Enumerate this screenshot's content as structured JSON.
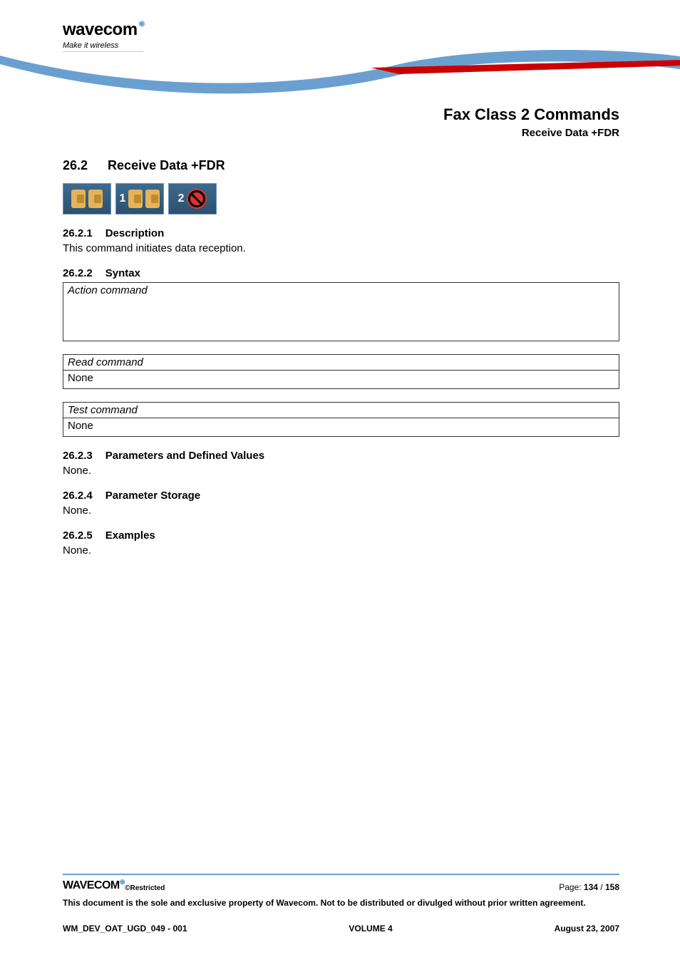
{
  "logo": {
    "brand": "wavecom",
    "tagline": "Make it wireless"
  },
  "page_header": {
    "title": "Fax Class 2 Commands",
    "subtitle": "Receive Data +FDR"
  },
  "section": {
    "number": "26.2",
    "title": "Receive Data +FDR"
  },
  "badges": [
    {
      "num": "",
      "kind": "sim"
    },
    {
      "num": "1",
      "kind": "sim"
    },
    {
      "num": "2",
      "kind": "no"
    }
  ],
  "sub1": {
    "number": "26.2.1",
    "title": "Description",
    "text": "This command initiates data reception."
  },
  "sub2": {
    "number": "26.2.2",
    "title": "Syntax"
  },
  "boxes": {
    "action": {
      "label": "Action command",
      "value": ""
    },
    "read": {
      "label": "Read command",
      "value": "None"
    },
    "test": {
      "label": "Test command",
      "value": "None"
    }
  },
  "sub3": {
    "number": "26.2.3",
    "title": "Parameters and Defined Values",
    "text": "None."
  },
  "sub4": {
    "number": "26.2.4",
    "title": "Parameter Storage",
    "text": "None."
  },
  "sub5": {
    "number": "26.2.5",
    "title": "Examples",
    "text": "None."
  },
  "footer": {
    "brand": "WAVECOM",
    "restricted": "©Restricted",
    "page_label": "Page: ",
    "page_current": "134",
    "page_sep": " / ",
    "page_total": "158",
    "disclaimer": "This document is the sole and exclusive property of Wavecom. Not to be distributed or divulged without prior written agreement.",
    "doc_id": "WM_DEV_OAT_UGD_049 - 001",
    "volume": "VOLUME 4",
    "date": "August 23, 2007"
  }
}
